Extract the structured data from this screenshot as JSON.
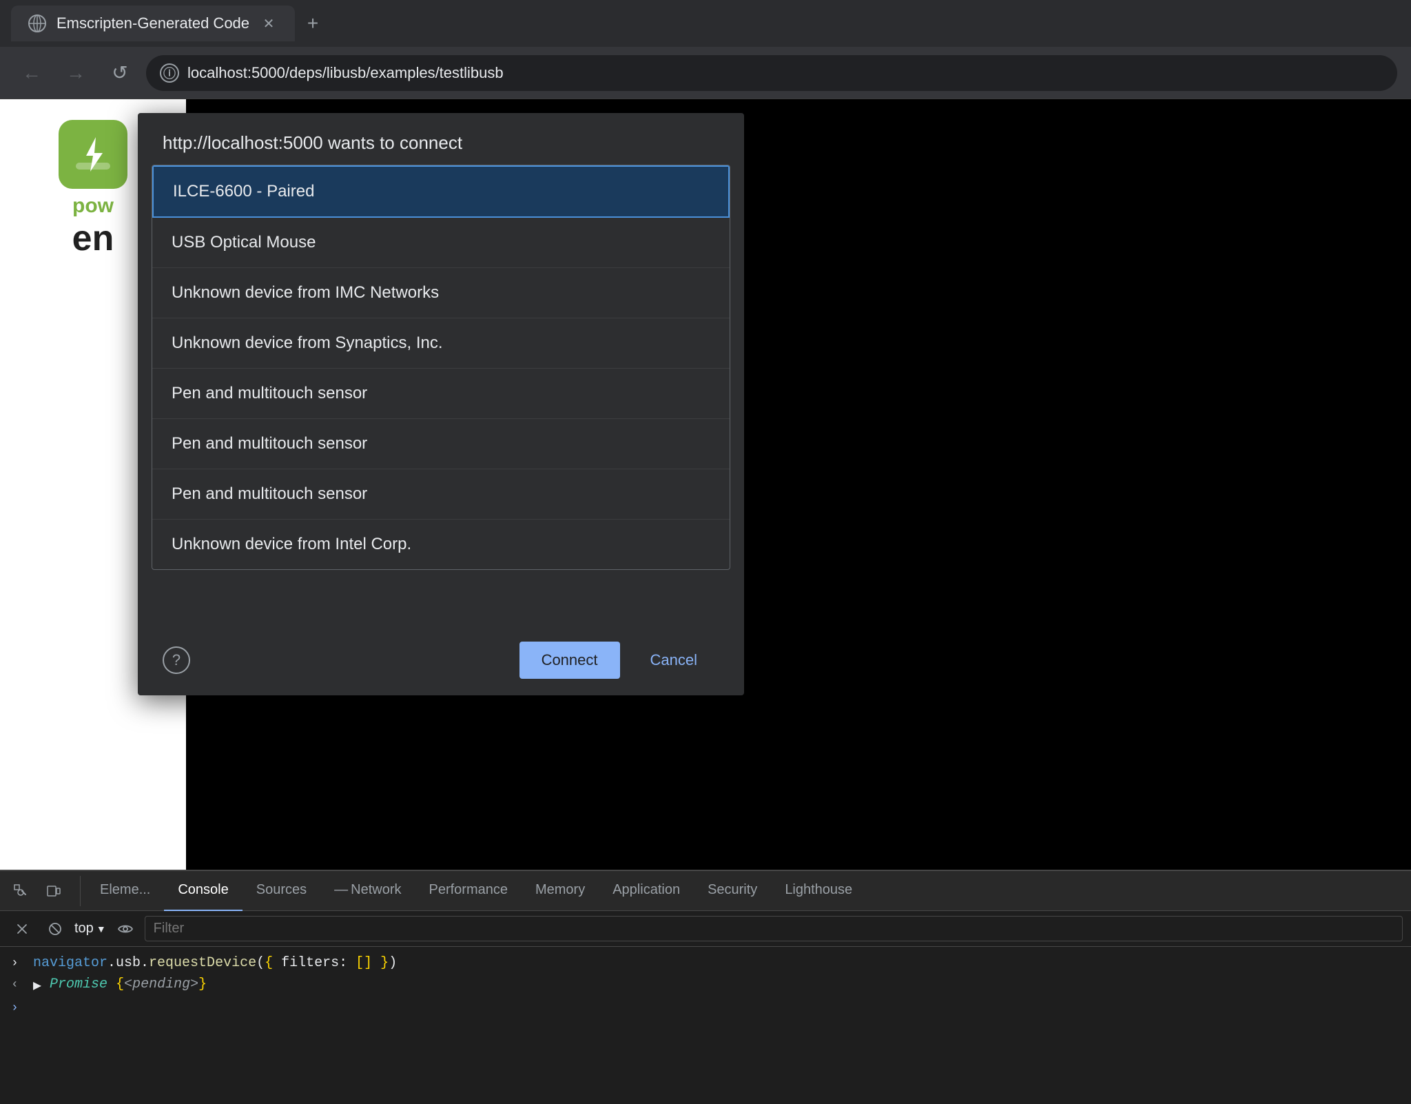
{
  "browser": {
    "tab": {
      "title": "Emscripten-Generated Code",
      "favicon_alt": "globe"
    },
    "new_tab_label": "+",
    "nav": {
      "back_label": "←",
      "forward_label": "→",
      "reload_label": "↺",
      "address": "localhost:5000/deps/libusb/examples/testlibusb"
    }
  },
  "page": {
    "icon_alt": "power",
    "title_green": "pow",
    "title_dark": "en"
  },
  "dialog": {
    "title": "http://localhost:5000 wants to connect",
    "devices": [
      {
        "name": "ILCE-6600 - Paired",
        "selected": true
      },
      {
        "name": "USB Optical Mouse",
        "selected": false
      },
      {
        "name": "Unknown device from IMC Networks",
        "selected": false
      },
      {
        "name": "Unknown device from Synaptics, Inc.",
        "selected": false
      },
      {
        "name": "Pen and multitouch sensor",
        "selected": false
      },
      {
        "name": "Pen and multitouch sensor",
        "selected": false
      },
      {
        "name": "Pen and multitouch sensor",
        "selected": false
      },
      {
        "name": "Unknown device from Intel Corp.",
        "selected": false
      }
    ],
    "connect_label": "Connect",
    "cancel_label": "Cancel"
  },
  "devtools": {
    "tabs": [
      {
        "label": "Eleme...",
        "active": false
      },
      {
        "label": "Console",
        "active": true
      },
      {
        "label": "Sources",
        "active": false
      },
      {
        "label": "Network",
        "active": false
      },
      {
        "label": "Performance",
        "active": false
      },
      {
        "label": "Memory",
        "active": false
      },
      {
        "label": "Application",
        "active": false
      },
      {
        "label": "Security",
        "active": false
      },
      {
        "label": "Lighthouse",
        "active": false
      }
    ],
    "toolbar": {
      "top_label": "top",
      "filter_placeholder": "Filter"
    },
    "console": {
      "line1": "navigator.usb.requestDevice({ filters: [] })",
      "line2": "Promise {<pending>}"
    }
  }
}
